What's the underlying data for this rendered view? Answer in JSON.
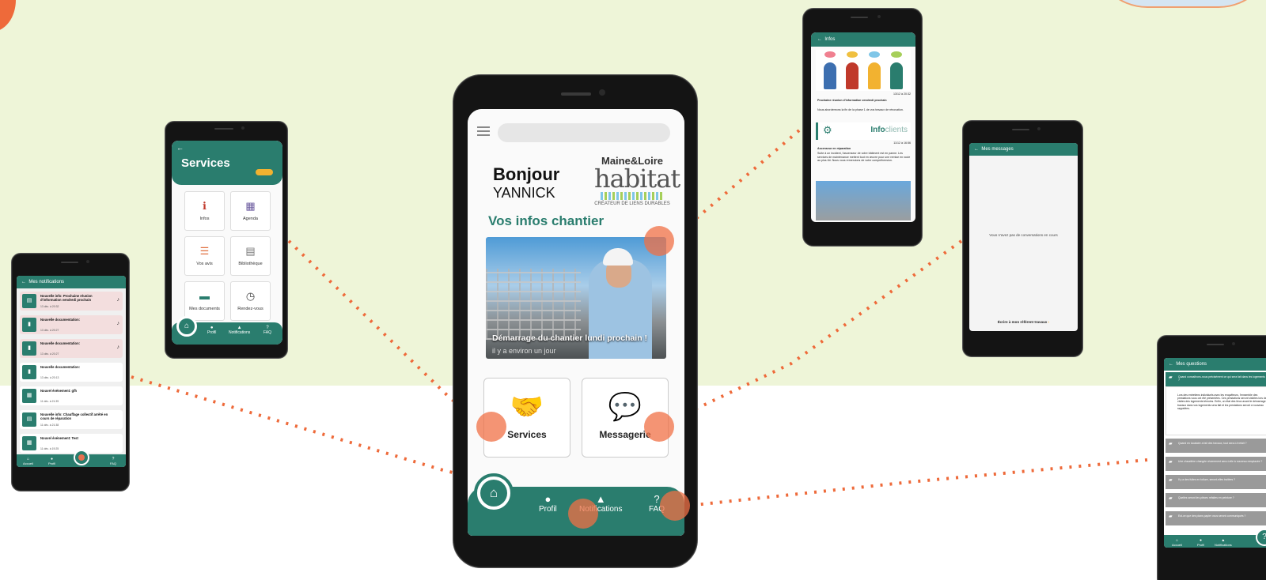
{
  "main": {
    "greeting": "Bonjour",
    "user_name": "YANNICK",
    "logo_line1": "Maine&Loire",
    "logo_line2": "habitat",
    "logo_tagline": "CRÉATEUR DE LIENS DURABLES",
    "section_title": "Vos infos chantier",
    "card_title": "Démarrage du chantier lundi prochain !",
    "card_time": "il y a environ un jour",
    "tiles": [
      {
        "label": "Services",
        "icon": "handshake-icon",
        "glyph": "🤝"
      },
      {
        "label": "Messagerie",
        "icon": "message-icon",
        "glyph": "💬"
      }
    ],
    "nav": {
      "profil": "Profil",
      "notifications": "Notifications",
      "faq": "FAQ"
    }
  },
  "services": {
    "title": "Services",
    "tiles": [
      {
        "label": "Infos",
        "glyph": "ℹ"
      },
      {
        "label": "Agenda",
        "glyph": "▦"
      },
      {
        "label": "Vos avis",
        "glyph": "☰"
      },
      {
        "label": "Bibliothèque",
        "glyph": "▤"
      },
      {
        "label": "Mes documents",
        "glyph": "▬"
      },
      {
        "label": "Rendez-vous",
        "glyph": "◷"
      }
    ],
    "nav": {
      "profil": "Profil",
      "notifications": "Notifications",
      "faq": "FAQ"
    }
  },
  "notifications": {
    "title": "Mes notifications",
    "items": [
      {
        "title": "Nouvelle info: Prochaine réunion d'information vendredi prochain",
        "date": "13 déc. à 20:32",
        "highlight": true
      },
      {
        "title": "Nouvelle documentation:",
        "date": "13 déc. à 20:27",
        "highlight": true
      },
      {
        "title": "Nouvelle documentation:",
        "date": "13 déc. à 20:27",
        "highlight": true
      },
      {
        "title": "Nouvelle documentation:",
        "date": "13 déc. à 20:13",
        "highlight": false
      },
      {
        "title": "Nouvel événement: gfh",
        "date": "11 déc. à 21:39",
        "highlight": false
      },
      {
        "title": "Nouvelle info: Chauffage collectif arrêté en cours de réparation",
        "date": "11 déc. à 21:38",
        "highlight": false
      },
      {
        "title": "Nouvel événement: Test",
        "date": "11 déc. à 19:25",
        "highlight": false
      }
    ],
    "nav": {
      "accueil": "Accueil",
      "profil": "Profil",
      "faq": "FAQ"
    }
  },
  "infos": {
    "title": "Infos",
    "post1_date": "13/12 à 20:32",
    "post1_title": "Prochaine réunion d'information vendredi prochain",
    "post1_body": "Nous abordereons la fin de la phase 1 de vos travaux de rénovation.",
    "logo_prefix": "Info",
    "logo_suffix": "clients",
    "post2_date": "11/12 à 16:56",
    "post2_title": "Ascenseur en réparation",
    "post2_body": "Suite à un incident, l'ascenseur de votre bâtiment est en panne. Les services de maintenance mettent tout en œuvre pour une remise en route au plus tôt. Nous vous remercions de votre compréhension."
  },
  "messages": {
    "title": "Mes messages",
    "empty": "Vous n'avez pas de conversations en cours",
    "write": "Écrire à mon référent travaux"
  },
  "questions": {
    "title": "Mes questions",
    "active_q": "Quand connaîtrons-nous précisément ce qui sera fait dans les logements ?",
    "answer": "Lors des entretiens individuels avec les enquêteurs, l'ensemble des prestations vous ont été présentées. Ces prestations seront visibles lors des visites des logements témoins. Enfin, un état des lieux avant le démarrage des travaux dans vos logements sera fait et les prestations seront à nouveau rappelées.",
    "items": [
      "Quand en locataire a fait des travaux, tout sera-t-il refait ?",
      "Une chaudière changée récemment sera-t-elle à nouveau remplacée ?",
      "Il y a des fuites en toiture, seront-elles traitées ?",
      "Quelles seront les pièces refaites en peinture ?",
      "Est-ce que des plans papier vous seront communiqués ?"
    ],
    "nav": {
      "accueil": "Accueil",
      "profil": "Profil",
      "notifications": "Notifications"
    }
  }
}
